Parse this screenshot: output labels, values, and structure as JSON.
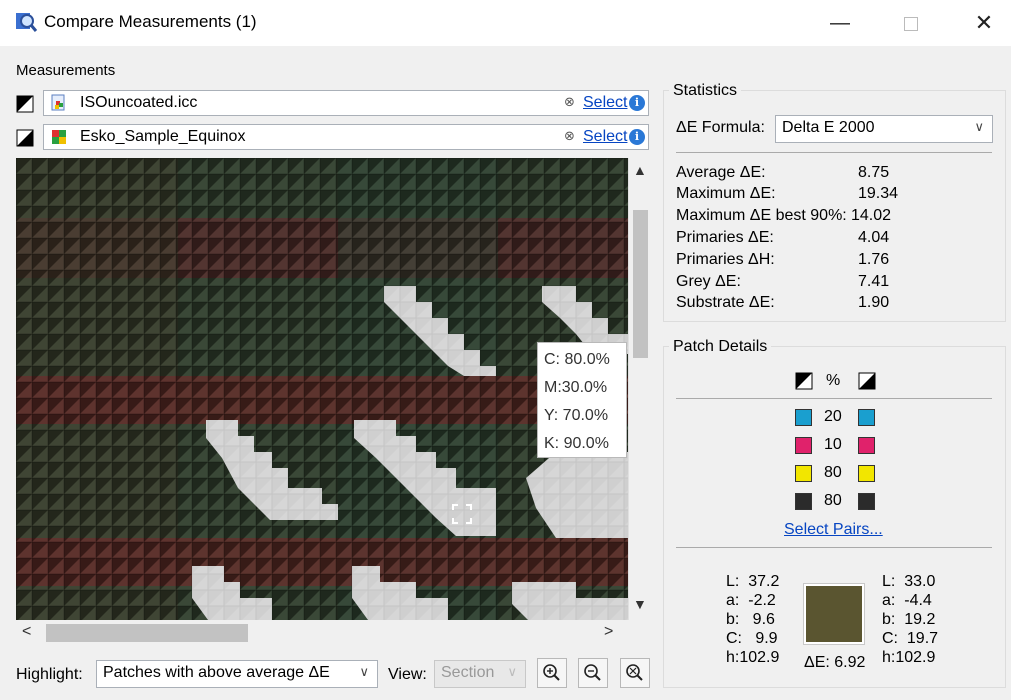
{
  "window": {
    "title": "Compare Measurements (1)",
    "minimize": "—",
    "close": "✕"
  },
  "measurements": {
    "label": "Measurements",
    "rows": [
      {
        "name": "ISOuncoated.icc",
        "select_label": "Select",
        "info": "i",
        "clear": "⊗"
      },
      {
        "name": "Esko_Sample_Equinox",
        "select_label": "Select",
        "info": "i",
        "clear": "⊗"
      }
    ]
  },
  "patch_view": {
    "tooltip": {
      "c": "C: 80.0%",
      "m": "M:30.0%",
      "y": "Y: 70.0%",
      "k": "K: 90.0%"
    },
    "scroll_up": "▲",
    "scroll_down": "▼",
    "scroll_left": "<",
    "scroll_right": ">"
  },
  "bottom_bar": {
    "highlight_label": "Highlight:",
    "highlight_value": "Patches with above average ΔE",
    "view_label": "View:",
    "view_value": "Section",
    "chevron": "∨"
  },
  "statistics": {
    "label": "Statistics",
    "formula_label": "ΔE Formula:",
    "formula_value": "Delta E 2000",
    "chevron": "∨",
    "rows": [
      {
        "name": "Average ΔE:",
        "value": "8.75"
      },
      {
        "name": "Maximum ΔE:",
        "value": "19.34"
      },
      {
        "name": "Maximum ΔE best 90%:",
        "value": "14.02"
      },
      {
        "name": "Primaries ΔE:",
        "value": "4.04"
      },
      {
        "name": "Primaries ΔH:",
        "value": "1.76"
      },
      {
        "name": "Grey ΔE:",
        "value": "7.41"
      },
      {
        "name": "Substrate ΔE:",
        "value": "1.90"
      }
    ]
  },
  "patch_details": {
    "label": "Patch Details",
    "percent_header": "%",
    "inks": [
      {
        "value": "20",
        "color": "#1a9fcf"
      },
      {
        "value": "10",
        "color": "#e0226b"
      },
      {
        "value": "80",
        "color": "#f2e600"
      },
      {
        "value": "80",
        "color": "#2b2b2b"
      }
    ],
    "select_pairs": "Select Pairs...",
    "left_lab": {
      "L": "L:  37.2",
      "a": "a:  -2.2",
      "b": "b:   9.6",
      "C": "C:   9.9",
      "h": "h:102.9"
    },
    "right_lab": {
      "L": "L:  33.0",
      "a": "a:  -4.4",
      "b": "b:  19.2",
      "C": "C:  19.7",
      "h": "h:102.9"
    },
    "delta_e": "ΔE: 6.92",
    "patch_color": "#5a5530"
  }
}
